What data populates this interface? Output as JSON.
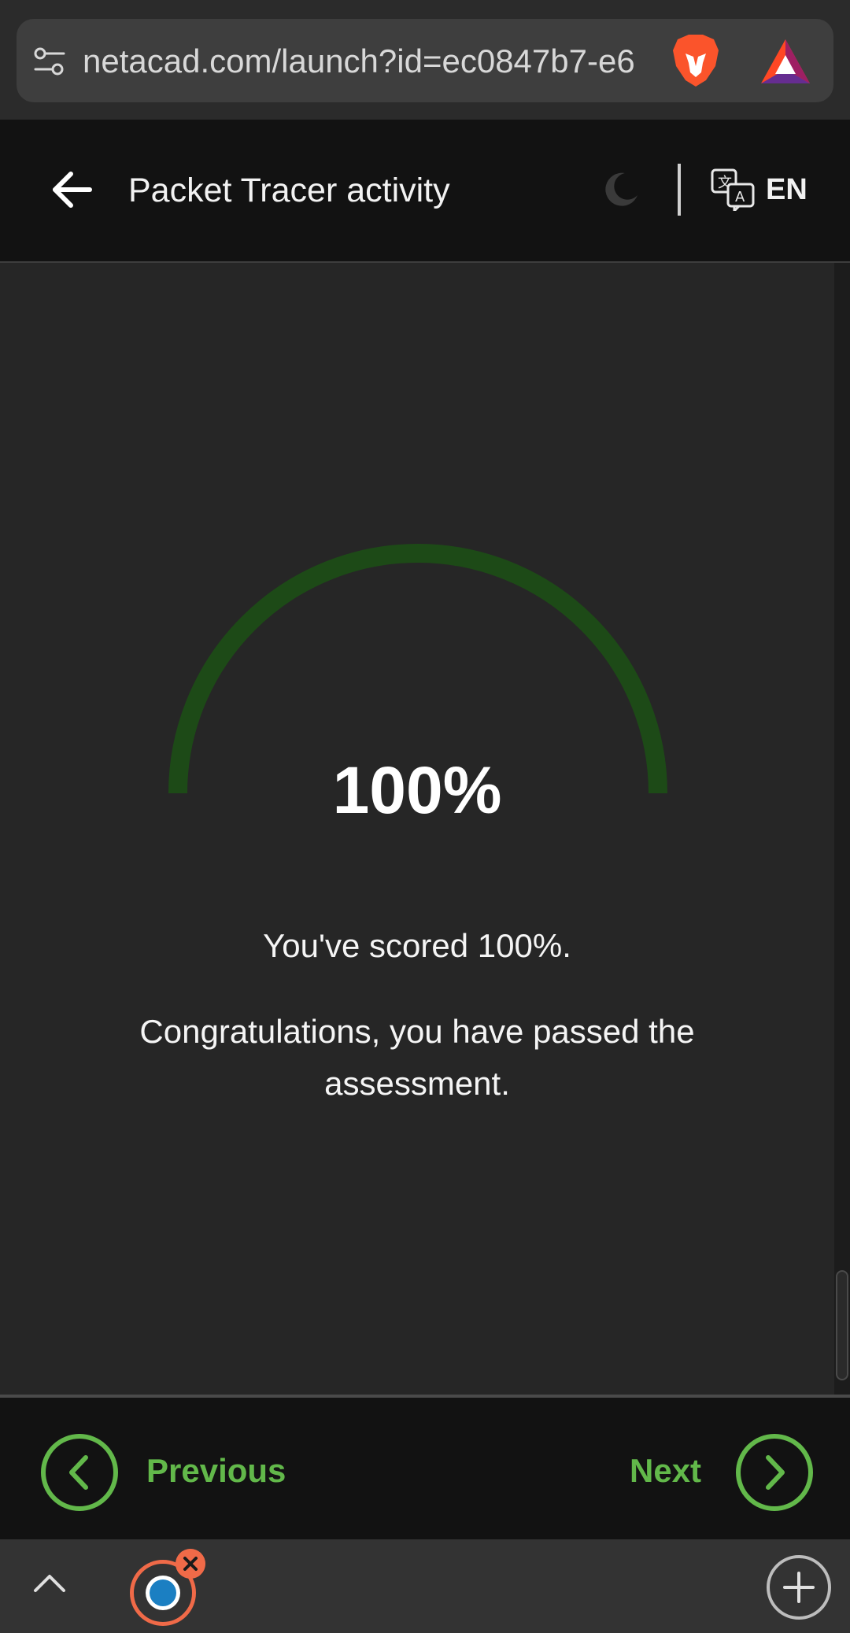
{
  "browser": {
    "url": "netacad.com/launch?id=ec0847b7-e6",
    "icons": [
      "site-settings-icon",
      "brave-lion-icon",
      "bat-rewards-icon"
    ]
  },
  "header": {
    "title": "Packet Tracer activity",
    "language": "EN",
    "icons": [
      "back-arrow-icon",
      "moon-icon",
      "translate-icon"
    ]
  },
  "result": {
    "percent_display": "100%",
    "percent_value": 100,
    "score_message": "You've scored 100%.",
    "congrats_message": "Congratulations, you have passed the assessment.",
    "gauge_color": "#1d4a17"
  },
  "nav": {
    "previous_label": "Previous",
    "next_label": "Next",
    "accent_color": "#62b84a"
  },
  "browser_toolbar": {
    "icons": [
      "chevron-up-icon",
      "tab-favicon-icon",
      "close-tab-icon",
      "new-tab-plus-icon"
    ]
  }
}
